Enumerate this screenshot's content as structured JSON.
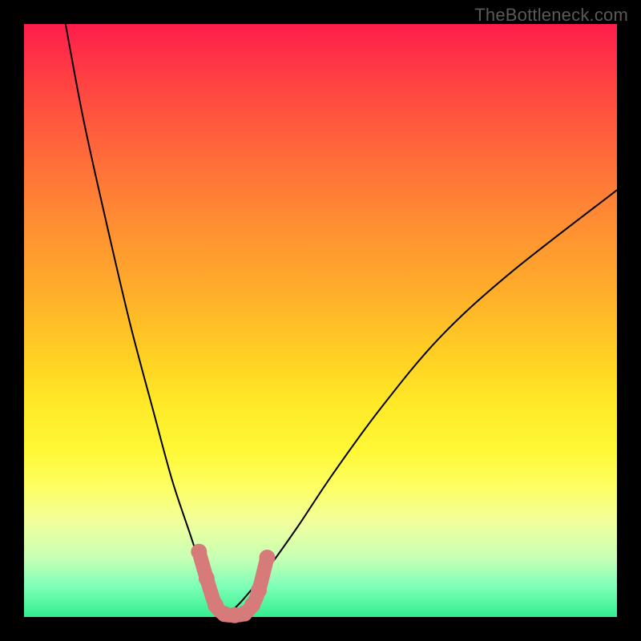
{
  "watermark": "TheBottleneck.com",
  "colors": {
    "marker": "#d67a7a",
    "curve": "#000000",
    "frame": "#000000"
  },
  "chart_data": {
    "type": "line",
    "title": "",
    "xlabel": "",
    "ylabel": "",
    "xlim": [
      0,
      100
    ],
    "ylim": [
      0,
      100
    ],
    "grid": false,
    "legend": "none",
    "series": [
      {
        "name": "left-branch",
        "x": [
          7,
          10,
          14,
          18,
          22,
          25,
          28,
          30,
          32,
          34
        ],
        "y": [
          100,
          84,
          66,
          49,
          34,
          23,
          14,
          8,
          3,
          0
        ]
      },
      {
        "name": "right-branch",
        "x": [
          34,
          37,
          41,
          46,
          52,
          60,
          70,
          82,
          100
        ],
        "y": [
          0,
          3,
          8,
          15,
          24,
          35,
          47,
          58,
          72
        ]
      },
      {
        "name": "markers",
        "marker_only": true,
        "x": [
          29.5,
          30.8,
          32.3,
          33.8,
          35.5,
          37.2,
          38.5,
          39.6,
          41.0
        ],
        "y": [
          11.0,
          6.5,
          2.0,
          0.5,
          0.3,
          0.6,
          2.0,
          4.5,
          10.0
        ]
      }
    ]
  }
}
